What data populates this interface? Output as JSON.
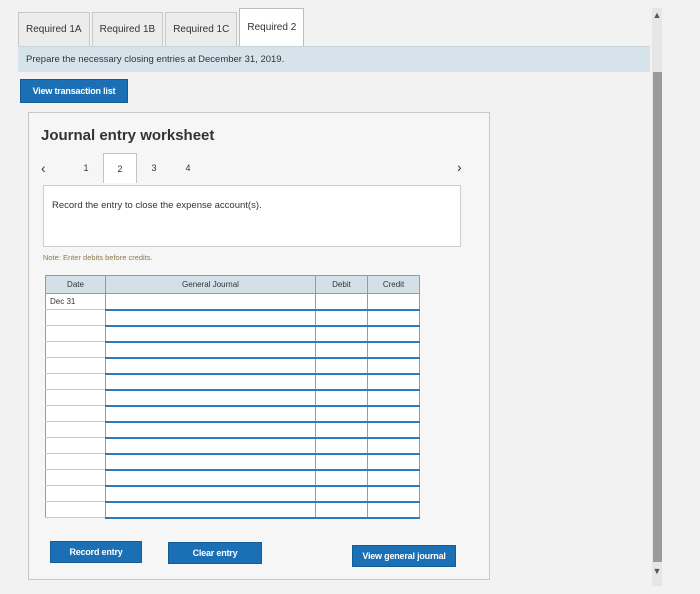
{
  "tabs": [
    {
      "label": "Required 1A"
    },
    {
      "label": "Required 1B"
    },
    {
      "label": "Required 1C"
    },
    {
      "label": "Required 2"
    }
  ],
  "instruction": "Prepare the necessary closing entries at December 31, 2019.",
  "buttons": {
    "view_transactions": "View transaction list",
    "record_entry": "Record entry",
    "clear_entry": "Clear entry",
    "view_general_journal": "View general journal"
  },
  "worksheet": {
    "title": "Journal entry worksheet",
    "pages": [
      "1",
      "2",
      "3",
      "4"
    ],
    "active_page": "2",
    "prompt": "Record the entry to close the expense account(s).",
    "note": "Note: Enter debits before credits."
  },
  "journal": {
    "headers": {
      "date": "Date",
      "account": "General Journal",
      "debit": "Debit",
      "credit": "Credit"
    },
    "rows": [
      {
        "date": "Dec 31"
      },
      {
        "date": ""
      },
      {
        "date": ""
      },
      {
        "date": ""
      },
      {
        "date": ""
      },
      {
        "date": ""
      },
      {
        "date": ""
      },
      {
        "date": ""
      },
      {
        "date": ""
      },
      {
        "date": ""
      },
      {
        "date": ""
      },
      {
        "date": ""
      },
      {
        "date": ""
      },
      {
        "date": ""
      }
    ]
  },
  "icons": {
    "chevron_left": "‹",
    "chevron_right": "›",
    "scroll_up": "▲",
    "scroll_down": "▼"
  }
}
